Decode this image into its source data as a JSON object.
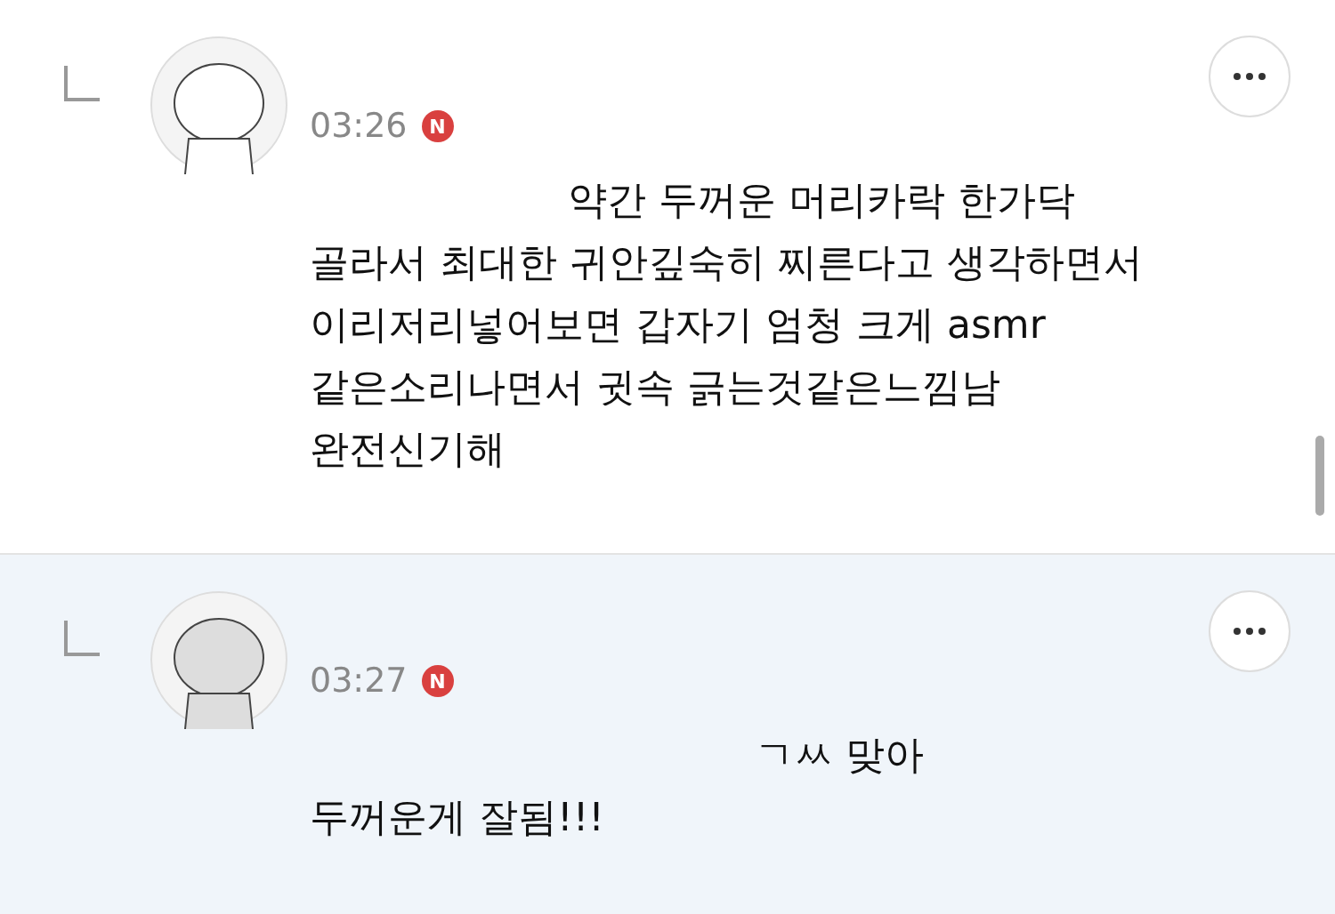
{
  "comments": [
    {
      "time": "03:26",
      "badge": "N",
      "highlighted": false,
      "lines": [
        "약간 두꺼운 머리카락 한가닥",
        "골라서 최대한  귀안깊숙히  찌른다고 생각하면서",
        "이리저리넣어보면 갑자기 엄청 크게 asmr",
        "같은소리나면서 귓속 긁는것같은느낌남",
        "완전신기해"
      ]
    },
    {
      "time": "03:27",
      "badge": "N",
      "highlighted": true,
      "lines": [
        "ㄱㅆ 맞아",
        "두꺼운게 잘됨!!!"
      ]
    }
  ]
}
